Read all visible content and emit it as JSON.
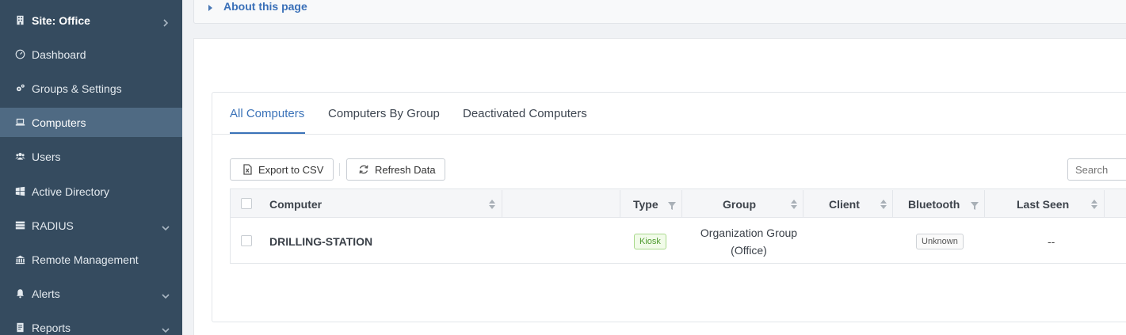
{
  "sidebar": {
    "site": "Site: Office",
    "items": [
      {
        "label": "Dashboard",
        "icon": "dashboard-gauge-icon"
      },
      {
        "label": "Groups & Settings",
        "icon": "gears-icon"
      },
      {
        "label": "Computers",
        "icon": "laptop-icon",
        "active": true
      },
      {
        "label": "Users",
        "icon": "users-icon"
      },
      {
        "label": "Active Directory",
        "icon": "windows-icon"
      },
      {
        "label": "RADIUS",
        "icon": "server-icon"
      },
      {
        "label": "Remote Management",
        "icon": "building-icon"
      },
      {
        "label": "Alerts",
        "icon": "bell-icon"
      },
      {
        "label": "Reports",
        "icon": "reports-icon"
      }
    ]
  },
  "about": {
    "label": "About this page"
  },
  "tabs": [
    {
      "label": "All Computers",
      "active": true
    },
    {
      "label": "Computers By Group"
    },
    {
      "label": "Deactivated Computers"
    }
  ],
  "toolbar": {
    "export_label": "Export to CSV",
    "refresh_label": "Refresh Data",
    "search_placeholder": "Search"
  },
  "table": {
    "columns": [
      "Computer",
      "Type",
      "Group",
      "Client",
      "Bluetooth",
      "Last Seen"
    ],
    "rows": [
      {
        "computer": "DRILLING-STATION",
        "type": "Kiosk",
        "group_line1": "Organization Group",
        "group_line2": "(Office)",
        "client": "",
        "bluetooth": "Unknown",
        "last_seen": "--"
      }
    ]
  },
  "colors": {
    "sidebar_bg": "#354b5f",
    "sidebar_active": "#4f6a83",
    "accent": "#3a72b8",
    "kiosk_green": "#4e9a2e"
  }
}
